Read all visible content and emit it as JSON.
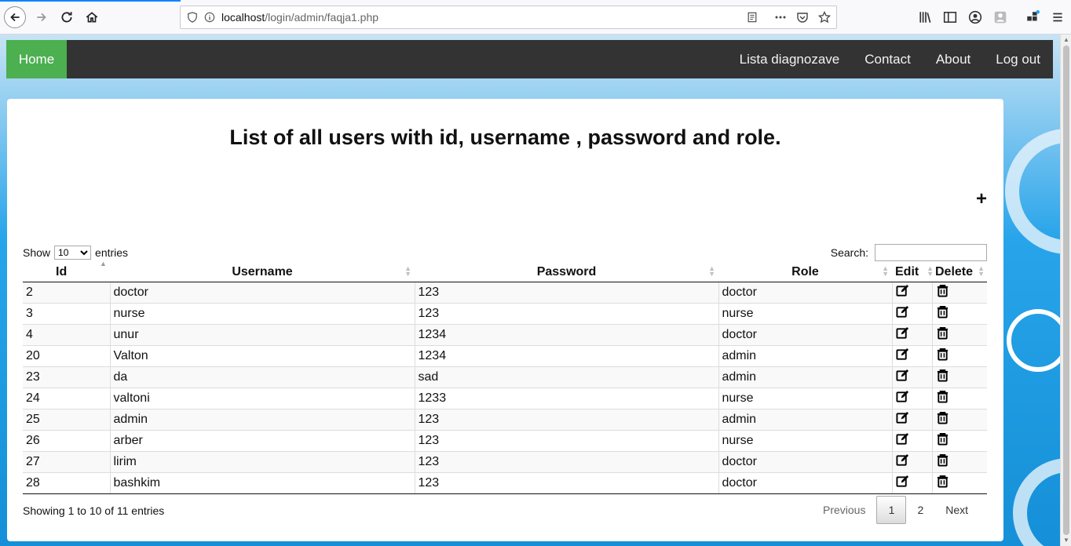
{
  "browser": {
    "url_host": "localhost",
    "url_path": "/login/admin/faqja1.php"
  },
  "nav": {
    "home": "Home",
    "links": [
      "Lista diagnozave",
      "Contact",
      "About",
      "Log out"
    ]
  },
  "page": {
    "title": "List of all users with id, username , password and role.",
    "add_symbol": "+"
  },
  "table_controls": {
    "show_label": "Show",
    "entries_label": "entries",
    "page_size": "10",
    "search_label": "Search:",
    "search_value": ""
  },
  "table": {
    "columns": [
      "Id",
      "Username",
      "Password",
      "Role",
      "Edit",
      "Delete"
    ],
    "rows": [
      {
        "id": "2",
        "username": "doctor",
        "password": "123",
        "role": "doctor"
      },
      {
        "id": "3",
        "username": "nurse",
        "password": "123",
        "role": "nurse"
      },
      {
        "id": "4",
        "username": "unur",
        "password": "1234",
        "role": "doctor"
      },
      {
        "id": "20",
        "username": "Valton",
        "password": "1234",
        "role": "admin"
      },
      {
        "id": "23",
        "username": "da",
        "password": "sad",
        "role": "admin"
      },
      {
        "id": "24",
        "username": "valtoni",
        "password": "1233",
        "role": "nurse"
      },
      {
        "id": "25",
        "username": "admin",
        "password": "123",
        "role": "admin"
      },
      {
        "id": "26",
        "username": "arber",
        "password": "123",
        "role": "nurse"
      },
      {
        "id": "27",
        "username": "lirim",
        "password": "123",
        "role": "doctor"
      },
      {
        "id": "28",
        "username": "bashkim",
        "password": "123",
        "role": "doctor"
      }
    ]
  },
  "footer": {
    "info": "Showing 1 to 10 of 11 entries",
    "previous": "Previous",
    "pages": [
      "1",
      "2"
    ],
    "next": "Next"
  }
}
